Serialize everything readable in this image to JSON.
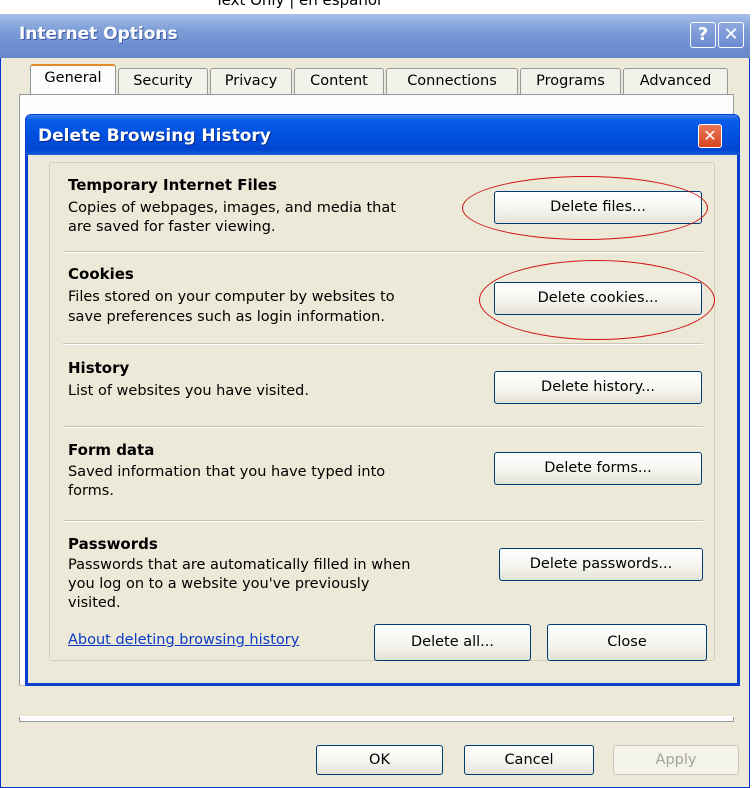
{
  "background": {
    "top_text": "Text Only  |  en español"
  },
  "outer": {
    "title": "Internet Options",
    "help_glyph": "?",
    "close_glyph": "✕",
    "tabs": [
      {
        "label": "General",
        "active": true
      },
      {
        "label": "Security",
        "active": false
      },
      {
        "label": "Privacy",
        "active": false
      },
      {
        "label": "Content",
        "active": false
      },
      {
        "label": "Connections",
        "active": false
      },
      {
        "label": "Programs",
        "active": false
      },
      {
        "label": "Advanced",
        "active": false
      }
    ],
    "buttons": {
      "ok": "OK",
      "cancel": "Cancel",
      "apply": "Apply"
    }
  },
  "dialog": {
    "title": "Delete Browsing History",
    "close_glyph": "✕",
    "sections": [
      {
        "title": "Temporary Internet Files",
        "desc": [
          "Copies of webpages, images, and media that",
          "are saved for faster viewing."
        ],
        "button": "Delete files...",
        "highlighted": true
      },
      {
        "title": "Cookies",
        "desc": [
          "Files stored on your computer by websites to",
          "save preferences such as login information."
        ],
        "button": "Delete cookies...",
        "highlighted": true
      },
      {
        "title": "History",
        "desc": [
          "List of websites you have visited."
        ],
        "button": "Delete history...",
        "highlighted": false
      },
      {
        "title": "Form data",
        "desc": [
          "Saved information that you have typed into",
          "forms."
        ],
        "button": "Delete forms...",
        "highlighted": false
      },
      {
        "title": "Passwords",
        "desc": [
          "Passwords that are automatically filled in when",
          "you log on to a website you've previously",
          "visited."
        ],
        "button": "Delete passwords...",
        "highlighted": false
      }
    ],
    "about_link": "About deleting browsing history",
    "delete_all": "Delete all...",
    "close": "Close"
  },
  "colors": {
    "window_face": "#ece9d8",
    "titlebar_blue": "#0050e0",
    "link_blue": "#0c3bc4",
    "annotation_red": "#d01010"
  }
}
